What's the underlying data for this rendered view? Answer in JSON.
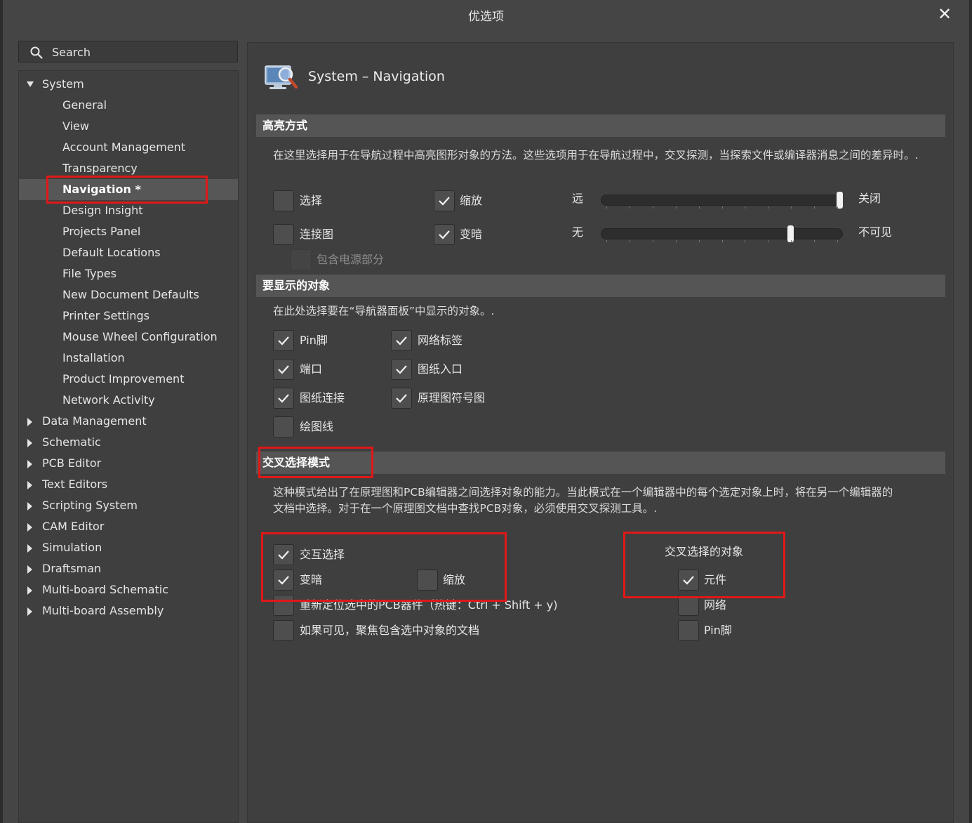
{
  "window": {
    "title": "优选项",
    "close_glyph": "✕"
  },
  "search": {
    "placeholder": "Search"
  },
  "tree": {
    "system": "System",
    "system_children": [
      "General",
      "View",
      "Account Management",
      "Transparency",
      "Navigation *",
      "Design Insight",
      "Projects Panel",
      "Default Locations",
      "File Types",
      "New Document Defaults",
      "Printer Settings",
      "Mouse Wheel Configuration",
      "Installation",
      "Product Improvement",
      "Network Activity"
    ],
    "selected": "Navigation *",
    "others": [
      "Data Management",
      "Schematic",
      "PCB Editor",
      "Text Editors",
      "Scripting System",
      "CAM Editor",
      "Simulation",
      "Draftsman",
      "Multi-board Schematic",
      "Multi-board Assembly"
    ]
  },
  "page": {
    "title": "System – Navigation",
    "icon": "navigation-magnifier-icon"
  },
  "highlight": {
    "header": "高亮方式",
    "desc": "在这里选择用于在导航过程中高亮图形对象的方法。这些选项用于在导航过程中，交叉探测，当探索文件或编译器消息之间的差异时。.",
    "select": {
      "label": "选择",
      "checked": false
    },
    "zoom": {
      "label": "缩放",
      "checked": true
    },
    "connection_graph": {
      "label": "连接图",
      "checked": false
    },
    "dim": {
      "label": "变暗",
      "checked": true
    },
    "include_power": {
      "label": "包含电源部分",
      "checked": false,
      "enabled": false
    },
    "zoom_slider": {
      "left": "远",
      "right": "关闭",
      "value": 1.0
    },
    "dim_slider": {
      "left": "无",
      "right": "不可见",
      "value": 0.79
    }
  },
  "objects": {
    "header": "要显示的对象",
    "desc": "在此处选择要在“导航器面板”中显示的对象。.",
    "pin": {
      "label": "Pin脚",
      "checked": true
    },
    "net_label": {
      "label": "网络标签",
      "checked": true
    },
    "port": {
      "label": "端口",
      "checked": true
    },
    "sheet_entry": {
      "label": "图纸入口",
      "checked": true
    },
    "sheet_connector": {
      "label": "图纸连接",
      "checked": true
    },
    "sheet_symbol": {
      "label": "原理图符号图",
      "checked": true
    },
    "graphic_lines": {
      "label": "绘图线",
      "checked": false
    }
  },
  "cross_select": {
    "header": "交叉选择模式",
    "desc": "这种模式给出了在原理图和PCB编辑器之间选择对象的能力。当此模式在一个编辑器中的每个选定对象上时，将在另一个编辑器的文档中选择。对于在一个原理图文档中查找PCB对象，必须使用交叉探测工具。.",
    "interactive": {
      "label": "交互选择",
      "checked": true
    },
    "dim": {
      "label": "变暗",
      "checked": true
    },
    "zoom": {
      "label": "缩放",
      "checked": false
    },
    "reposition": {
      "label": "重新定位选中的PCB器件（热键：Ctrl + Shift + y)",
      "checked": false
    },
    "focus_doc": {
      "label": "如果可见，聚焦包含选中对象的文档",
      "checked": false
    },
    "objects_title": "交叉选择的对象",
    "components": {
      "label": "元件",
      "checked": true
    },
    "nets": {
      "label": "网络",
      "checked": false
    },
    "pins": {
      "label": "Pin脚",
      "checked": false
    }
  },
  "colors": {
    "background": "#454545",
    "panel": "#3f3f3f",
    "section_bar": "#555555",
    "highlight_box": "#e01818",
    "selected_row": "#575757"
  }
}
